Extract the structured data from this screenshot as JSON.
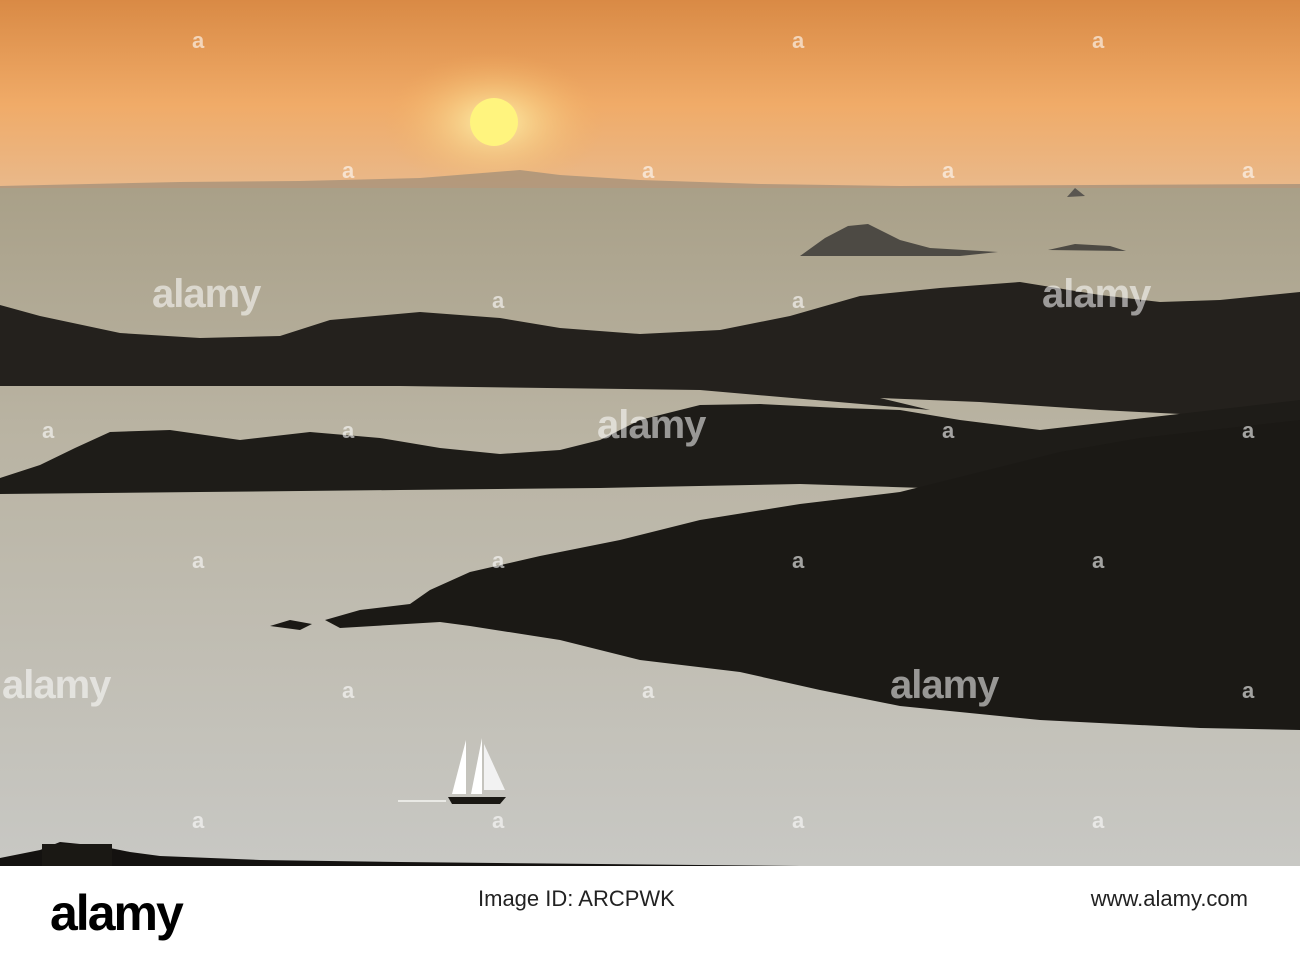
{
  "image": {
    "description_free": true,
    "colors": {
      "sky_top": "#e89a4c",
      "sky_horizon": "#f2b16e",
      "sun": "#fff48a",
      "sea_far": "#b3a990",
      "sea_near": "#c9c8c2",
      "land": "#1d1b17",
      "sail": "#ffffff"
    }
  },
  "watermark": {
    "brand": "alamy",
    "mark": "a"
  },
  "footer": {
    "logo": "alamy",
    "image_id": "Image ID: ARCPWK",
    "site": "www.alamy.com"
  }
}
